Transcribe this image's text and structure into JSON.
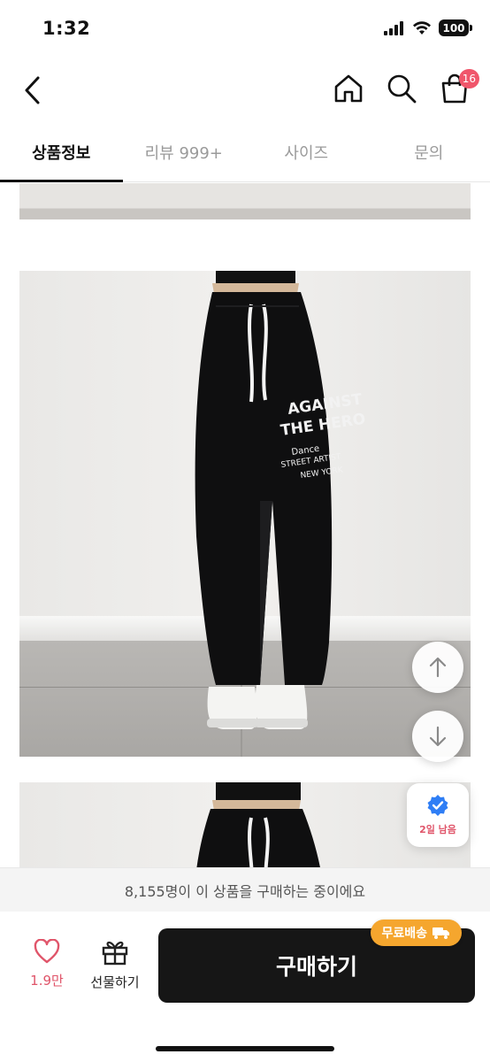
{
  "status_bar": {
    "time": "1:32",
    "battery": "100"
  },
  "nav": {
    "cart_count": "16"
  },
  "tabs": [
    {
      "label": "상품정보",
      "active": true
    },
    {
      "label": "리뷰 999+",
      "active": false
    },
    {
      "label": "사이즈",
      "active": false
    },
    {
      "label": "문의",
      "active": false
    }
  ],
  "product_print": {
    "line1": "AGAINST",
    "line2": "THE HERO",
    "line3": "Dance",
    "line4": "STREET ARTIST",
    "line5": "NEW YORK"
  },
  "deadline": {
    "label": "2일 남음"
  },
  "buying_now": "8,155명이 이 상품을 구매하는 중이에요",
  "bottom": {
    "like_count": "1.9만",
    "gift_label": "선물하기",
    "buy_label": "구매하기",
    "free_shipping_label": "무료배송"
  },
  "colors": {
    "accent_pink": "#e0556a",
    "badge": "#f0566b",
    "free_ship": "#f5a62e",
    "buy_button": "#161616"
  }
}
